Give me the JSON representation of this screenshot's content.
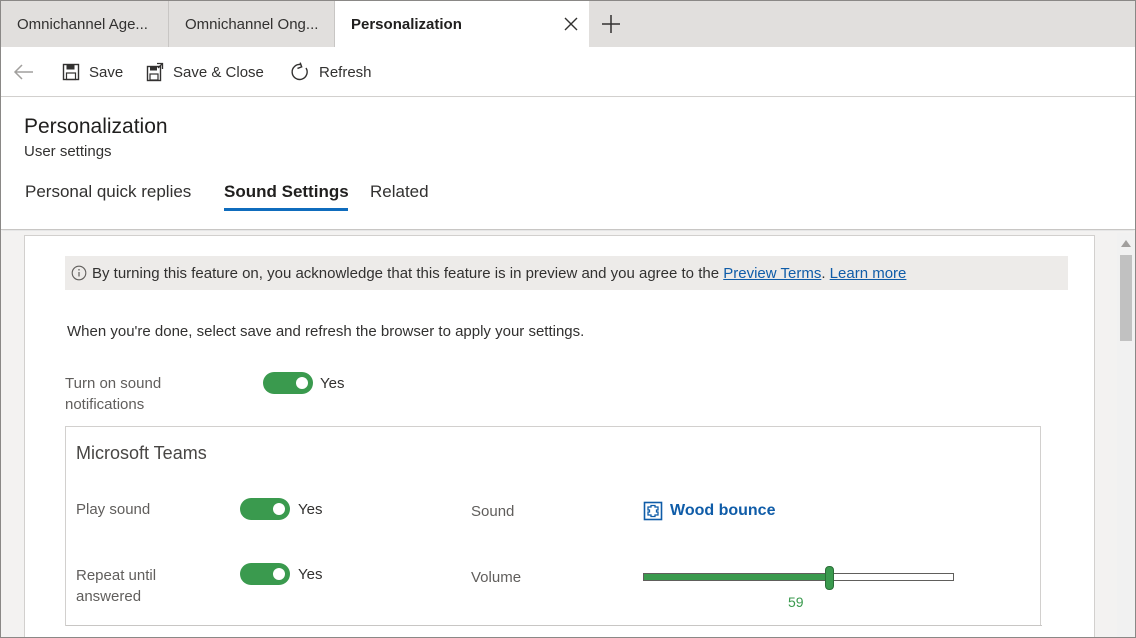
{
  "tabs": [
    {
      "label": "Omnichannel Age..."
    },
    {
      "label": "Omnichannel Ong..."
    },
    {
      "label": "Personalization"
    }
  ],
  "toolbar": {
    "save_label": "Save",
    "save_close_label": "Save & Close",
    "refresh_label": "Refresh"
  },
  "header": {
    "title": "Personalization",
    "subtitle": "User settings",
    "form_tabs": [
      {
        "label": "Personal quick replies"
      },
      {
        "label": "Sound Settings"
      },
      {
        "label": "Related"
      }
    ]
  },
  "info": {
    "text": "By turning this feature on, you acknowledge that this feature is in preview and you agree to the",
    "preview_terms": "Preview Terms",
    "separator": ".",
    "learn_more": "Learn more"
  },
  "hint": "When you're done, select save and refresh the browser to apply your settings.",
  "sound_notifications": {
    "label": "Turn on sound notifications",
    "value": "Yes",
    "on": true
  },
  "teams": {
    "title": "Microsoft Teams",
    "play_sound": {
      "label": "Play sound",
      "value": "Yes",
      "on": true
    },
    "repeat": {
      "label": "Repeat until answered",
      "value": "Yes",
      "on": true
    },
    "sound": {
      "label": "Sound",
      "value": "Wood bounce"
    },
    "volume": {
      "label": "Volume",
      "value": 59,
      "max": 100
    }
  },
  "colors": {
    "accent": "#0f6cbd",
    "toggle_on": "#3a9a4e",
    "link": "#0f5ca8"
  },
  "icons": [
    "back-arrow-icon",
    "save-icon",
    "save-close-icon",
    "refresh-icon",
    "close-icon",
    "add-tab-icon",
    "info-icon",
    "sound-file-icon"
  ]
}
